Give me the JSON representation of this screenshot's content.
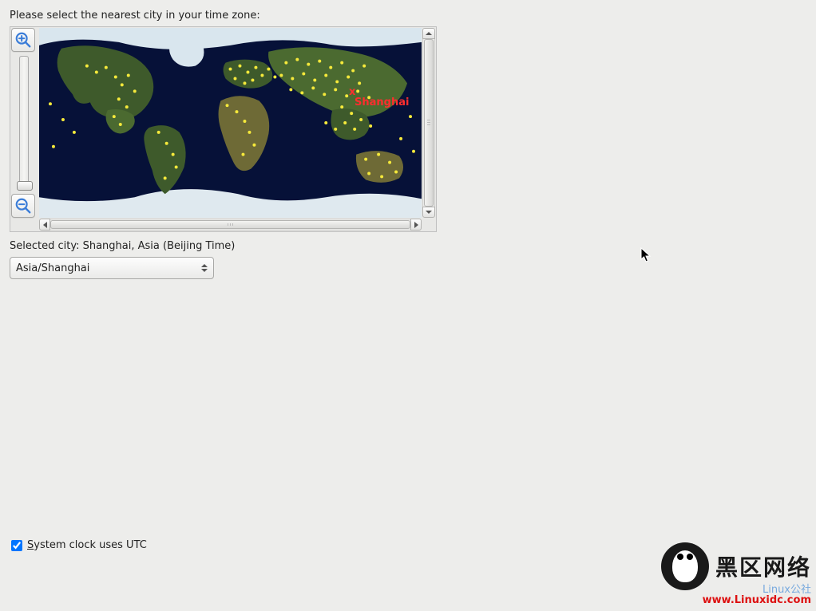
{
  "prompt": "Please select the nearest city in your time zone:",
  "selected_city_label": "Selected city: Shanghai, Asia (Beijing Time)",
  "timezone_value": "Asia/Shanghai",
  "marker_city": "Shanghai",
  "checkbox": {
    "label_prefix": "S",
    "label_rest": "ystem clock uses UTC",
    "checked": true
  },
  "watermark": {
    "cn": "黑区网络",
    "blue": "Linux公社",
    "url": "www.Linuxidc.com"
  },
  "icons": {
    "zoom_in": "zoom-in-icon",
    "zoom_out": "zoom-out-icon"
  }
}
